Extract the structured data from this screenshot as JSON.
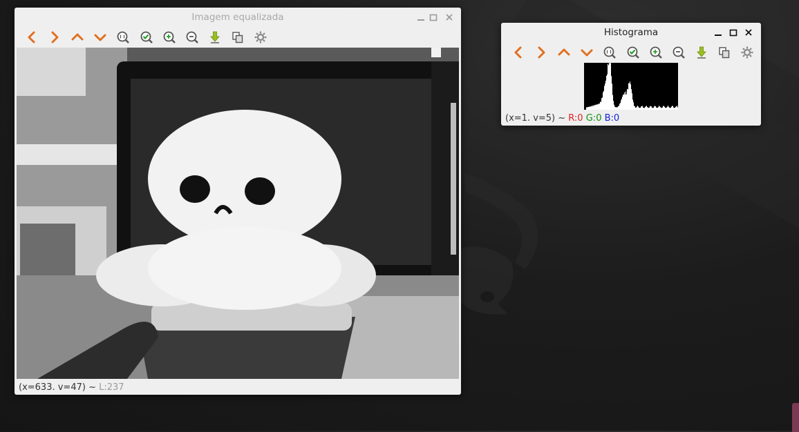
{
  "image_window": {
    "title": "Imagem equalizada",
    "status": {
      "coords": "(x=633. v=47) ~",
      "luma": "L:237"
    }
  },
  "histogram_window": {
    "title": "Histograma",
    "status": {
      "coords": "(x=1. v=5) ~",
      "r": "R:0",
      "g": "G:0",
      "b": "B:0"
    }
  },
  "window_controls": [
    "minimize-icon",
    "maximize-icon",
    "close-icon"
  ],
  "toolbar": {
    "buttons": [
      {
        "name": "pan-left-button",
        "icon": "chevron-left-icon"
      },
      {
        "name": "pan-right-button",
        "icon": "chevron-right-icon"
      },
      {
        "name": "pan-up-button",
        "icon": "chevron-up-icon"
      },
      {
        "name": "pan-down-button",
        "icon": "chevron-down-icon"
      },
      {
        "name": "zoom-original-button",
        "icon": "zoom-1to1-icon"
      },
      {
        "name": "zoom-fit-button",
        "icon": "zoom-fit-check-icon"
      },
      {
        "name": "zoom-in-button",
        "icon": "zoom-in-icon"
      },
      {
        "name": "zoom-out-button",
        "icon": "zoom-out-icon"
      },
      {
        "name": "save-image-button",
        "icon": "download-arrow-icon"
      },
      {
        "name": "copy-image-button",
        "icon": "copy-icon"
      },
      {
        "name": "properties-button",
        "icon": "gear-icon"
      }
    ]
  },
  "colors": {
    "window_bg": "#efefef",
    "chevron_orange": "#e07020",
    "check_green": "#2aa02a",
    "download_yellow_green": "#9ac020",
    "status_red": "#e02020",
    "status_green": "#109010",
    "status_blue": "#1020e0",
    "inactive_title": "#a8a8a8"
  }
}
